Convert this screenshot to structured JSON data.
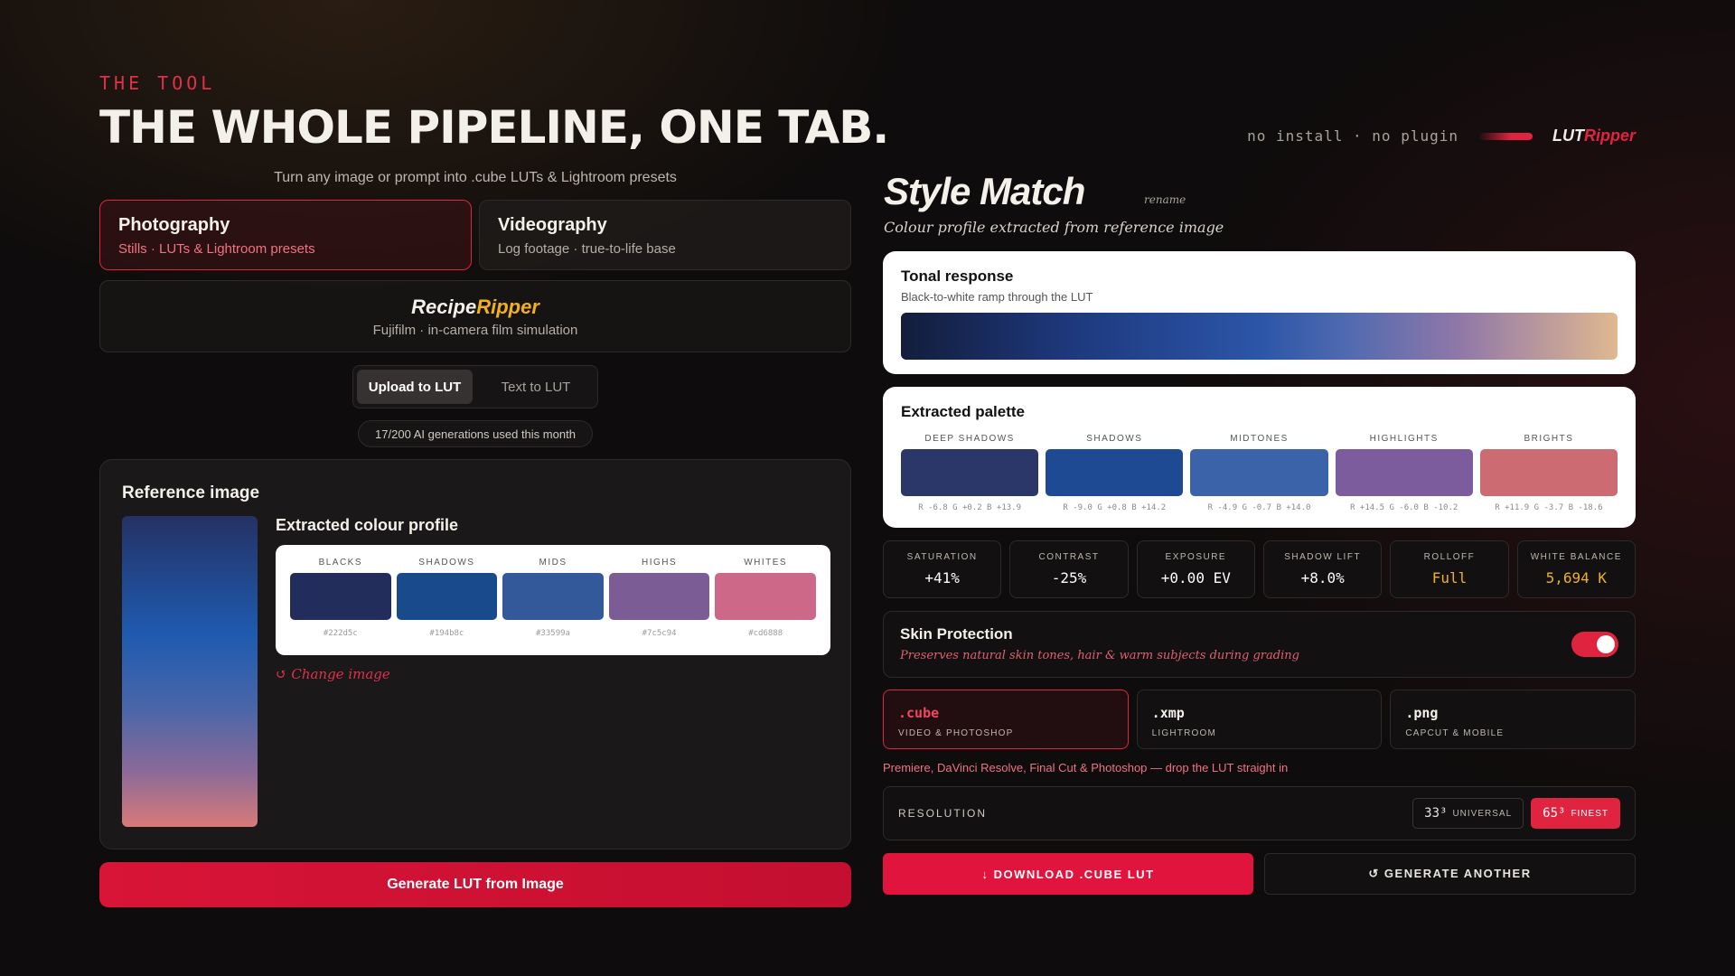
{
  "header": {
    "eyebrow": "THE TOOL",
    "headline": "THE WHOLE PIPELINE, ONE TAB.",
    "subline": "Turn any image or prompt into .cube LUTs & Lightroom presets",
    "meta": "no install · no plugin",
    "brand_a": "LUT",
    "brand_b": "Ripper"
  },
  "modes": [
    {
      "title": "Photography",
      "sub": "Stills · LUTs & Lightroom presets"
    },
    {
      "title": "Videography",
      "sub": "Log footage · true-to-life base"
    }
  ],
  "recipe": {
    "logo_a": "Recipe",
    "logo_b": "Ripper",
    "sub": "Fujifilm · in-camera film simulation"
  },
  "segment": {
    "upload": "Upload to LUT",
    "text": "Text to LUT"
  },
  "usage": "17/200 AI generations used this month",
  "reference": {
    "title": "Reference image",
    "profile_title": "Extracted colour profile",
    "swatches": [
      {
        "name": "BLACKS",
        "hex": "#222d5c",
        "color": "#222d5c"
      },
      {
        "name": "SHADOWS",
        "hex": "#194b8c",
        "color": "#194b8c"
      },
      {
        "name": "MIDS",
        "hex": "#33599a",
        "color": "#33599a"
      },
      {
        "name": "HIGHS",
        "hex": "#7c5c94",
        "color": "#7c5c94"
      },
      {
        "name": "WHITES",
        "hex": "#cd6888",
        "color": "#cd6888"
      }
    ],
    "change": "↺ Change image"
  },
  "generate": "Generate LUT from Image",
  "style_match": {
    "title": "Style Match",
    "rename": "rename",
    "sub": "Colour profile extracted from reference image"
  },
  "tonal": {
    "title": "Tonal response",
    "sub": "Black-to-white ramp through the LUT"
  },
  "palette": {
    "title": "Extracted palette",
    "items": [
      {
        "name": "DEEP SHADOWS",
        "rgb": "R -6.8 G +0.2 B +13.9",
        "color": "#2b3768"
      },
      {
        "name": "SHADOWS",
        "rgb": "R -9.0 G +0.8 B +14.2",
        "color": "#1e4a94"
      },
      {
        "name": "MIDTONES",
        "rgb": "R -4.9 G -0.7 B +14.0",
        "color": "#3a63aa"
      },
      {
        "name": "HIGHLIGHTS",
        "rgb": "R +14.5 G -6.0 B -10.2",
        "color": "#7c5c9c"
      },
      {
        "name": "BRIGHTS",
        "rgb": "R +11.9 G -3.7 B -18.6",
        "color": "#cc6c72"
      }
    ]
  },
  "stats": [
    {
      "label": "SATURATION",
      "value": "+41%"
    },
    {
      "label": "CONTRAST",
      "value": "-25%"
    },
    {
      "label": "EXPOSURE",
      "value": "+0.00 EV"
    },
    {
      "label": "SHADOW LIFT",
      "value": "+8.0%"
    },
    {
      "label": "ROLLOFF",
      "value": "Full"
    },
    {
      "label": "WHITE BALANCE",
      "value": "5,694 K"
    }
  ],
  "skin": {
    "title": "Skin Protection",
    "sub": "Preserves natural skin tones, hair & warm subjects during grading",
    "enabled": true
  },
  "formats": [
    {
      "ext": ".cube",
      "desc": "VIDEO & PHOTOSHOP"
    },
    {
      "ext": ".xmp",
      "desc": "LIGHTROOM"
    },
    {
      "ext": ".png",
      "desc": "CAPCUT & MOBILE"
    }
  ],
  "format_note": "Premiere, DaVinci Resolve, Final Cut & Photoshop — drop the LUT straight in",
  "resolution": {
    "label": "RESOLUTION",
    "opt1": "33³",
    "opt1_tag": "UNIVERSAL",
    "opt2": "65³",
    "opt2_tag": "FINEST"
  },
  "download": "↓ DOWNLOAD .CUBE LUT",
  "again": "↺ GENERATE ANOTHER"
}
